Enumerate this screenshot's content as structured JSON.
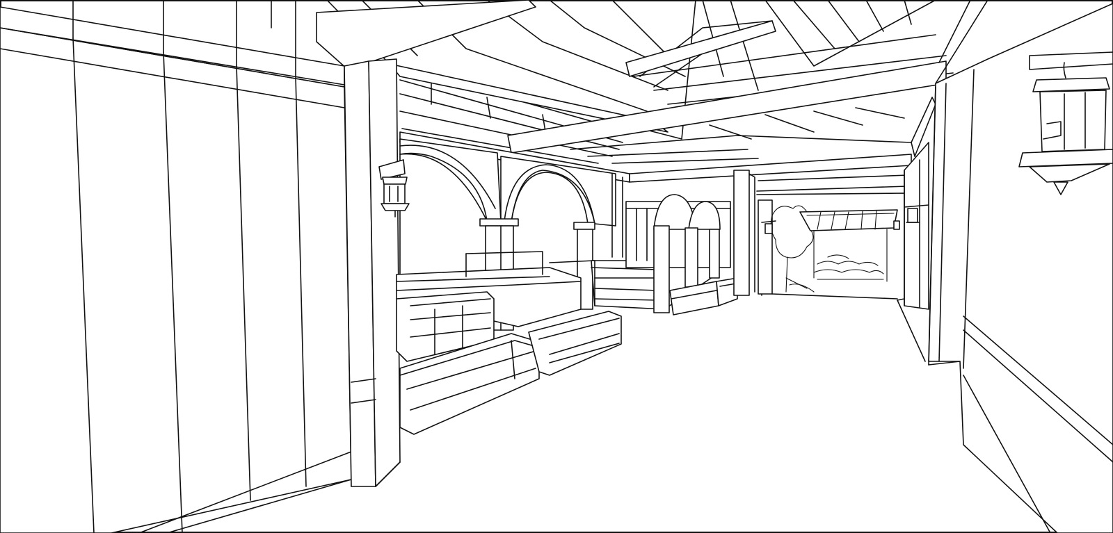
{
  "scene": {
    "subject": "",
    "style": "black line art on white"
  },
  "colors": {
    "line": "#111111",
    "background": "#ffffff"
  }
}
